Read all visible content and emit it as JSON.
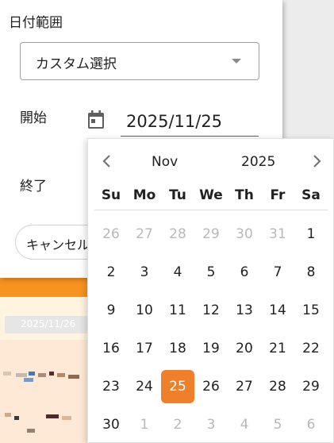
{
  "dialog": {
    "title": "日付範囲",
    "select_value": "カスタム選択",
    "start_label": "開始",
    "start_date": "2025/11/25",
    "end_label": "終了",
    "cancel_label": "キャンセル"
  },
  "background": {
    "chip_date": "2025/11/26",
    "accent_color": "#f7931e"
  },
  "calendar": {
    "month": "Nov",
    "year": "2025",
    "weekdays": [
      "Su",
      "Mo",
      "Tu",
      "We",
      "Th",
      "Fr",
      "Sa"
    ],
    "weeks": [
      [
        {
          "d": "26",
          "o": true
        },
        {
          "d": "27",
          "o": true
        },
        {
          "d": "28",
          "o": true
        },
        {
          "d": "29",
          "o": true
        },
        {
          "d": "30",
          "o": true
        },
        {
          "d": "31",
          "o": true
        },
        {
          "d": "1"
        }
      ],
      [
        {
          "d": "2"
        },
        {
          "d": "3"
        },
        {
          "d": "4"
        },
        {
          "d": "5"
        },
        {
          "d": "6"
        },
        {
          "d": "7"
        },
        {
          "d": "8"
        }
      ],
      [
        {
          "d": "9"
        },
        {
          "d": "10"
        },
        {
          "d": "11"
        },
        {
          "d": "12"
        },
        {
          "d": "13"
        },
        {
          "d": "14"
        },
        {
          "d": "15"
        }
      ],
      [
        {
          "d": "16"
        },
        {
          "d": "17"
        },
        {
          "d": "18"
        },
        {
          "d": "19"
        },
        {
          "d": "20"
        },
        {
          "d": "21"
        },
        {
          "d": "22"
        }
      ],
      [
        {
          "d": "23"
        },
        {
          "d": "24"
        },
        {
          "d": "25",
          "s": true
        },
        {
          "d": "26"
        },
        {
          "d": "27"
        },
        {
          "d": "28"
        },
        {
          "d": "29"
        }
      ],
      [
        {
          "d": "30"
        },
        {
          "d": "1",
          "o": true
        },
        {
          "d": "2",
          "o": true
        },
        {
          "d": "3",
          "o": true
        },
        {
          "d": "4",
          "o": true
        },
        {
          "d": "5",
          "o": true
        },
        {
          "d": "6",
          "o": true
        }
      ]
    ],
    "selected_color": "#f07f2a",
    "icons": {
      "prev": "chevron-left-icon",
      "next": "chevron-right-icon",
      "date": "calendar-icon"
    }
  }
}
